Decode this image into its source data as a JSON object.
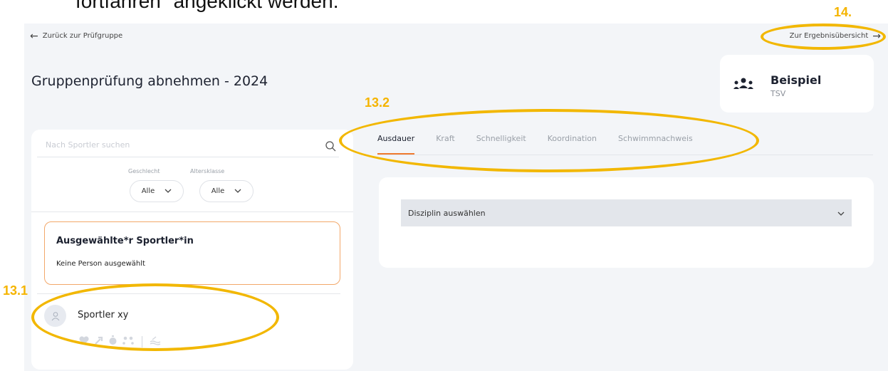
{
  "document": {
    "text": "fortfahren\" angeklickt werden."
  },
  "header": {
    "back_label": "Zurück zur Prüfgruppe",
    "results_label": "Zur Ergebnisübersicht",
    "page_title": "Gruppenprüfung abnehmen - 2024"
  },
  "club": {
    "name": "Beispiel",
    "sub": "TSV"
  },
  "sidebar": {
    "search_placeholder": "Nach Sportler suchen",
    "filters": [
      {
        "label": "Geschlecht",
        "value": "Alle"
      },
      {
        "label": "Altersklasse",
        "value": "Alle"
      }
    ],
    "selected_title": "Ausgewählte*r Sportler*in",
    "selected_sub": "Keine Person ausgewählt",
    "athletes": [
      {
        "name": "Sportler xy"
      }
    ]
  },
  "tabs": [
    {
      "label": "Ausdauer",
      "active": true
    },
    {
      "label": "Kraft",
      "active": false
    },
    {
      "label": "Schnelligkeit",
      "active": false
    },
    {
      "label": "Koordination",
      "active": false
    },
    {
      "label": "Schwimmnachweis",
      "active": false
    }
  ],
  "main": {
    "discipline_placeholder": "Disziplin auswählen"
  },
  "annotations": {
    "a14": "14.",
    "a13_2": "13.2",
    "a13_1": "13.1"
  },
  "colors": {
    "accent": "#ef7a2f",
    "highlight": "#f2b700",
    "background": "#f3f5f8"
  }
}
